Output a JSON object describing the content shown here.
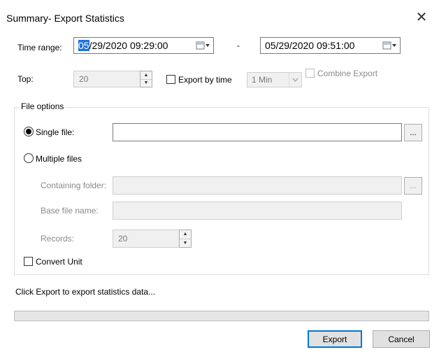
{
  "window": {
    "title": "Summary- Export Statistics"
  },
  "time_range": {
    "label": "Time range:",
    "start_selected": "05",
    "start_rest": "/29/2020 09:29:00",
    "separator": "-",
    "end": "05/29/2020 09:51:00"
  },
  "top": {
    "label": "Top:",
    "value": "20",
    "export_by_time_label": "Export by time",
    "interval_value": "1 Min",
    "combine_export_label": "Combine  Export"
  },
  "file_options": {
    "legend": "File options",
    "single_file_label": "Single file:",
    "single_file_path": "",
    "browse_label": "...",
    "multiple_files_label": "Multiple files",
    "containing_folder_label": "Containing folder:",
    "containing_folder_value": "",
    "base_file_name_label": "Base file name:",
    "base_file_name_value": "",
    "records_label": "Records:",
    "records_value": "20",
    "convert_unit_label": "Convert Unit"
  },
  "status": {
    "text": "Click Export to export statistics data...",
    "progress": 0
  },
  "buttons": {
    "export": "Export",
    "cancel": "Cancel"
  }
}
